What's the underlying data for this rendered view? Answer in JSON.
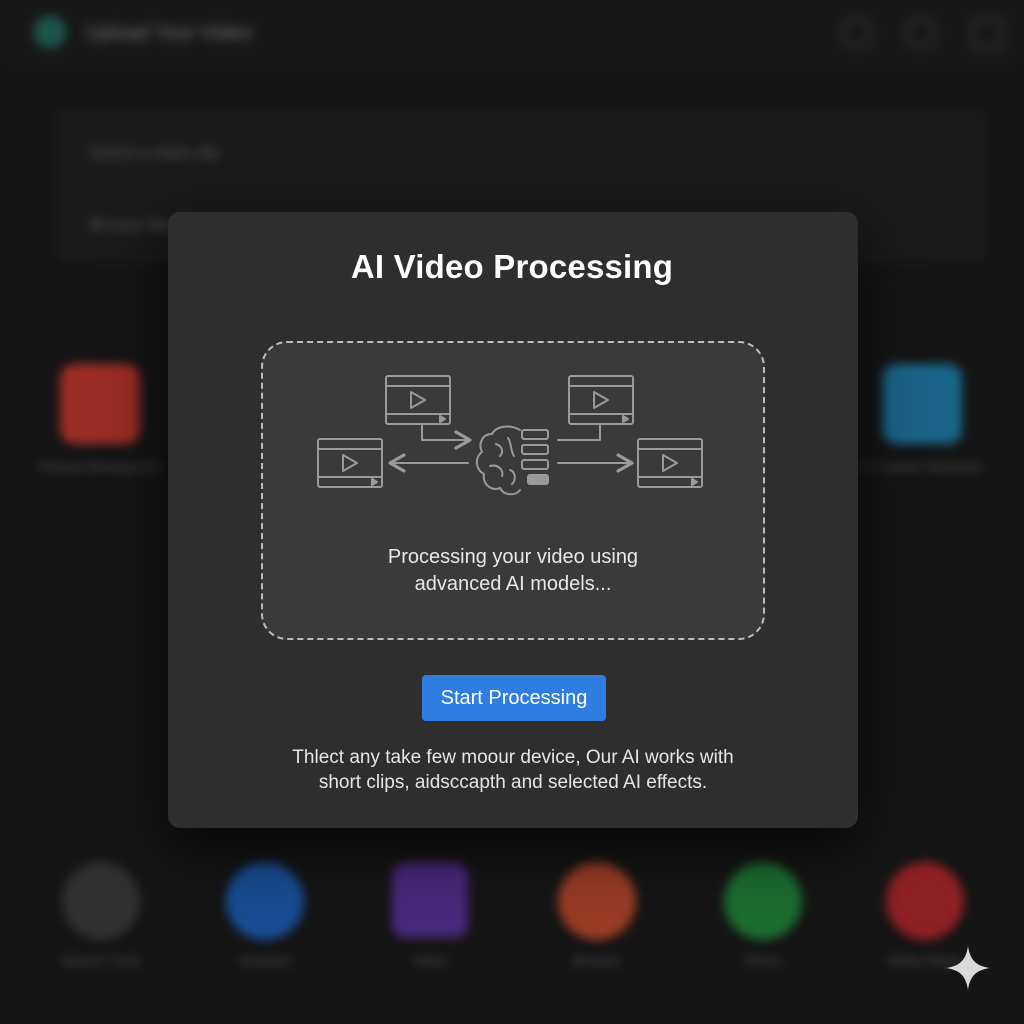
{
  "background_app": {
    "title": "Upload Your Video",
    "panel_rows": [
      "Select a video clip",
      "Browse files"
    ],
    "tiles": [
      {
        "label": "Remove Background",
        "color": "#c8352a"
      },
      {
        "label": "AI Caption Generator",
        "color": "#1c7fb0"
      }
    ],
    "dock": [
      {
        "label": "Speech Track",
        "color": "#555555"
      },
      {
        "label": "Assistant",
        "color": "#1a5fbf"
      },
      {
        "label": "Notes",
        "color": "#5b2f9e"
      },
      {
        "label": "Browser",
        "color": "#c44a2a"
      },
      {
        "label": "Phone",
        "color": "#1f8a3a"
      },
      {
        "label": "Media Player",
        "color": "#b8242a"
      }
    ]
  },
  "modal": {
    "title": "AI Video Processing",
    "drop_text_line1": "Processing your video using",
    "drop_text_line2": "advanced AI models...",
    "button_label": "Start Processing",
    "footnote_line1": "Thlect any take few moour device, Our AI works with",
    "footnote_line2": "short clips, aidsccapth and selected AI effects."
  },
  "colors": {
    "accent": "#2f7de1",
    "modal_bg": "#2e2e2e",
    "dropzone_bg": "#3a3a3a"
  },
  "icons": [
    "video-frame-icon",
    "brain-icon",
    "sparkle-icon"
  ]
}
